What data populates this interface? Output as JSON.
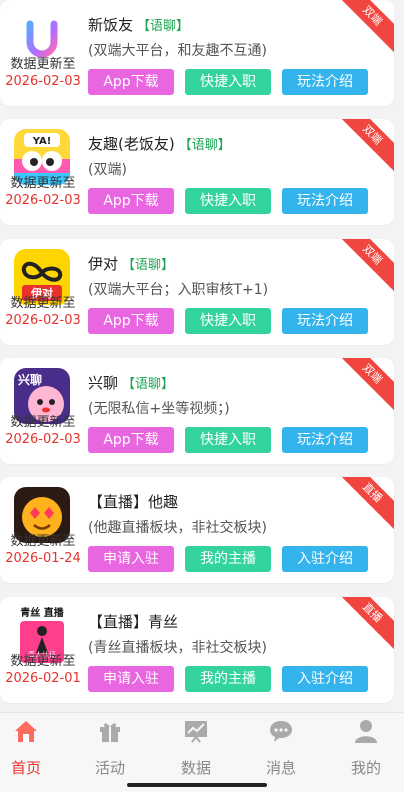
{
  "cards": [
    {
      "title": "新饭友",
      "tag": "【语聊】",
      "desc": "(双端大平台，和友趣不互通)",
      "update_label": "数据更新至",
      "update_date": "2026-02-03",
      "ribbon": "双端",
      "buttons": [
        "App下载",
        "快捷入职",
        "玩法介绍"
      ],
      "icon": "u-logo-icon"
    },
    {
      "title": "友趣(老饭友)",
      "tag": "【语聊】",
      "desc": "(双端)",
      "update_label": "数据更新至",
      "update_date": "2026-02-03",
      "ribbon": "双端",
      "buttons": [
        "App下载",
        "快捷入职",
        "玩法介绍"
      ],
      "icon": "yaa-cartoon-icon"
    },
    {
      "title": "伊对",
      "tag": "【语聊】",
      "desc": "(双端大平台；入职审核T+1)",
      "update_label": "数据更新至",
      "update_date": "2026-02-03",
      "ribbon": "双端",
      "buttons": [
        "App下载",
        "快捷入职",
        "玩法介绍"
      ],
      "icon": "yidui-logo-icon"
    },
    {
      "title": "兴聊",
      "tag": "【语聊】",
      "desc": "(无限私信+坐等视频；)",
      "update_label": "数据更新至",
      "update_date": "2026-02-03",
      "ribbon": "双端",
      "buttons": [
        "App下载",
        "快捷入职",
        "玩法介绍"
      ],
      "icon": "xingliao-cartoon-icon"
    },
    {
      "title": "【直播】他趣",
      "tag": "",
      "desc": "(他趣直播板块，非社交板块)",
      "update_label": "数据更新至",
      "update_date": "2026-01-24",
      "ribbon": "直播",
      "buttons": [
        "申请入驻",
        "我的主播",
        "入驻介绍"
      ],
      "icon": "heart-eyes-emoji-icon"
    },
    {
      "title": "【直播】青丝",
      "tag": "",
      "desc": "(青丝直播板块，非社交板块)",
      "update_label": "数据更新至",
      "update_date": "2026-02-01",
      "ribbon": "直播",
      "buttons": [
        "申请入驻",
        "我的主播",
        "入驻介绍"
      ],
      "icon": "qingsi-live-icon",
      "icon_text": "青丝 直播",
      "icon_badge": "真人认证"
    }
  ],
  "tabs": [
    {
      "label": "首页",
      "icon": "home-icon",
      "active": true
    },
    {
      "label": "活动",
      "icon": "gift-icon",
      "active": false
    },
    {
      "label": "数据",
      "icon": "chart-board-icon",
      "active": false
    },
    {
      "label": "消息",
      "icon": "message-icon",
      "active": false
    },
    {
      "label": "我的",
      "icon": "person-icon",
      "active": false
    }
  ],
  "colors": {
    "accent": "#e8322c",
    "tag": "#1aa352",
    "btn_pink": "#e866e0",
    "btn_green": "#33d49b",
    "btn_blue": "#33b4ec",
    "ribbon": "#f0463f"
  }
}
